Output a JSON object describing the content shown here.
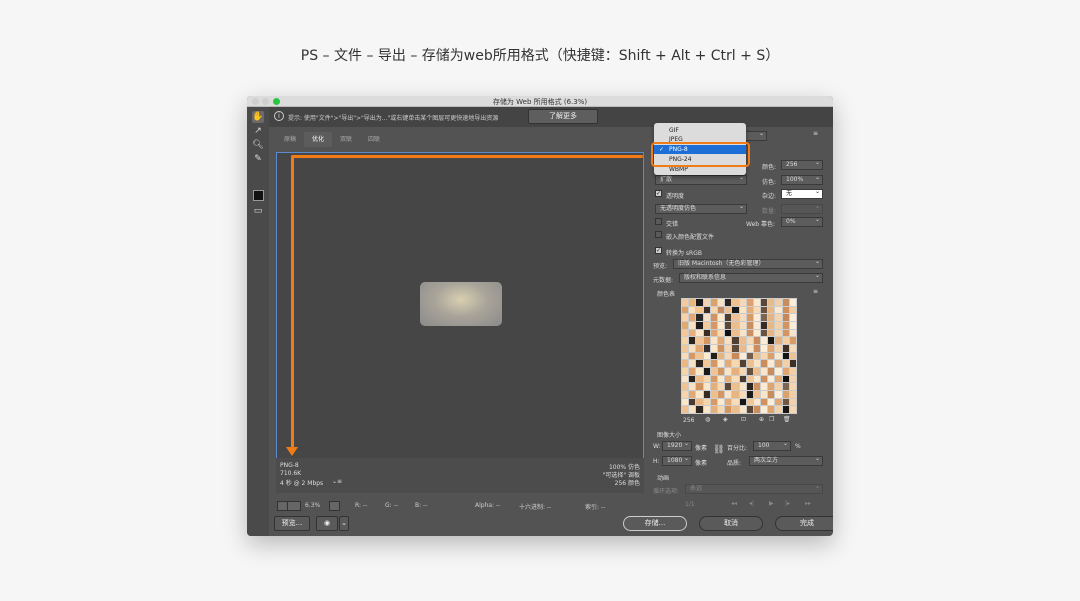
{
  "caption": "PS – 文件 – 导出 – 存储为web所用格式（快捷键：Shift + Alt + Ctrl + S）",
  "window": {
    "title": "存储为 Web 所用格式 (6.3%)",
    "hint": "提示: 使用\"文件\">\"导出\">\"导出为...\"或右键单击某个图层可更快速地导出资源",
    "learn_more": "了解更多"
  },
  "tabs": [
    "原稿",
    "优化",
    "双联",
    "四联"
  ],
  "image_info": {
    "format": "PNG-8",
    "size": "710.6K",
    "speed": "4 秒 @ 2 Mbps",
    "dither": "100% 仿色",
    "palette": "\"可选择\" 调板",
    "colors": "256 颜色"
  },
  "status": {
    "zoom": "6.3%",
    "r": "R: --",
    "g": "G: --",
    "b": "B: --",
    "alpha": "Alpha: --",
    "hex": "十六进制: --",
    "index": "索引: --"
  },
  "bottom": {
    "preview": "预览...",
    "save": "存储...",
    "cancel": "取消",
    "done": "完成"
  },
  "format_dropdown": {
    "options": [
      "GIF",
      "JPEG",
      "PNG-8",
      "PNG-24",
      "WBMP"
    ],
    "selected": "PNG-8"
  },
  "settings": {
    "colors_label": "颜色:",
    "colors_value": "256",
    "dither_label": "仿色:",
    "dither_value": "100%",
    "reduction_value": "扩散",
    "transparency_label": "透明度",
    "matte_label": "杂边:",
    "matte_value": "无",
    "trans_dither_value": "无透明度仿色",
    "amount_label": "数量:",
    "interlaced_label": "交错",
    "web_snap_label": "Web 靠色:",
    "web_snap_value": "0%",
    "embed_profile_label": "嵌入颜色配置文件",
    "convert_srgb_label": "转换为 sRGB",
    "preview_label": "预览:",
    "preview_value": "旧版 Macintosh（无色彩管理）",
    "metadata_label": "元数据:",
    "metadata_value": "版权和联系信息",
    "color_table_label": "颜色表",
    "color_count": "256",
    "image_size_label": "图像大小",
    "w_label": "W:",
    "w_value": "1920",
    "h_label": "H:",
    "h_value": "1080",
    "unit": "像素",
    "percent_label": "百分比:",
    "percent_value": "100",
    "percent_sign": "%",
    "quality_label": "品质:",
    "quality_value": "两次立方",
    "animation_label": "动画",
    "loop_label": "循环选项:",
    "loop_value": "永远",
    "frame_counter": "1/1"
  },
  "colors": {
    "accent_orange": "#f07b17",
    "selection_blue": "#1d6fd6",
    "panel_bg": "#535353"
  },
  "color_table": [
    "#f3c9a0",
    "#e8b77a",
    "#1a1a1a",
    "#f1d3b2",
    "#d9a46c",
    "#f7e3c8",
    "#2b2420",
    "#efc191",
    "#f5d9b8",
    "#e0a070",
    "#fbe8cf",
    "#5a4636",
    "#e8bb8a",
    "#f0cfa8",
    "#c98c5e",
    "#f9eedc",
    "#dba26e",
    "#fbe1bd",
    "#f4c58f",
    "#3b2f27",
    "#f6d6ad",
    "#c4895d",
    "#f1bf8e",
    "#181818",
    "#fae4c4",
    "#e4ac78",
    "#f7dcb6",
    "#6b5240",
    "#eab885",
    "#f9e9d2",
    "#d08e5c",
    "#f2cda2",
    "#f7d2a9",
    "#e3a874",
    "#2a2a2a",
    "#f5e1c7",
    "#cf9364",
    "#fde9cc",
    "#4d3d31",
    "#eec298",
    "#f6dcbc",
    "#d89b68",
    "#fbecd7",
    "#7a6552",
    "#e6b382",
    "#f4d3ae",
    "#c78758",
    "#faeedf",
    "#e0a873",
    "#f8e2c3",
    "#1f1b18",
    "#f0c99c",
    "#d69966",
    "#fcead0",
    "#594737",
    "#ebbe8e",
    "#f7ddbd",
    "#ca8f5f",
    "#f8ead6",
    "#362c25",
    "#e9b985",
    "#f3d0a6",
    "#d39560",
    "#f9ecd9",
    "#f2c898",
    "#e6af7c",
    "#f9e6cc",
    "#3a2d24",
    "#dfa46f",
    "#f6dab5",
    "#101010",
    "#eebe8d",
    "#f8e4c8",
    "#cd9061",
    "#fbebd3",
    "#6a5341",
    "#e8b682",
    "#f4d4ad",
    "#d29563",
    "#f7e6cf",
    "#f6d4ab",
    "#2d231d",
    "#efc597",
    "#d49762",
    "#fae7c9",
    "#e2aa76",
    "#f8dfbe",
    "#4f3f32",
    "#ecbd8d",
    "#f5d8b4",
    "#c98b5b",
    "#f9ebd5",
    "#1c1916",
    "#e5b07d",
    "#f2cea3",
    "#d89c67",
    "#f1c799",
    "#f7e0c0",
    "#e1a772",
    "#313131",
    "#f9e8cc",
    "#d0925f",
    "#f5d6af",
    "#5f4b3b",
    "#eabb89",
    "#f8e5c9",
    "#cc8e5d",
    "#fbeed9",
    "#dfa671",
    "#f3d2a9",
    "#402f27",
    "#f6dbb9",
    "#f8dcb7",
    "#d69864",
    "#f0c595",
    "#fbebd1",
    "#231e1a",
    "#e7b480",
    "#f6d9b3",
    "#c88a5a",
    "#faecd8",
    "#745e4b",
    "#ebbd8b",
    "#f4d5ae",
    "#da9f6b",
    "#f9e7cd",
    "#141414",
    "#eec293",
    "#e9b884",
    "#f7e2c5",
    "#2f2620",
    "#f1c999",
    "#d59863",
    "#fbead0",
    "#e3ab77",
    "#f5d7b0",
    "#524234",
    "#edc092",
    "#f8e3c6",
    "#cb8d5c",
    "#fae9d3",
    "#dca36e",
    "#f3d1a7",
    "#3d3029",
    "#f4d5ac",
    "#e0a571",
    "#fae8ce",
    "#191919",
    "#efc496",
    "#d39661",
    "#f9e4c7",
    "#e6b17e",
    "#f6d8b2",
    "#665040",
    "#ebbe8c",
    "#f8e6cb",
    "#c98c5c",
    "#fbecd5",
    "#dfa470",
    "#f2cfa5",
    "#f9e6ca",
    "#282220",
    "#ebba87",
    "#f5d6ae",
    "#d79a66",
    "#fbe9cf",
    "#e4ad79",
    "#f7ddba",
    "#473a2e",
    "#f0c796",
    "#f9e9d0",
    "#ce905f",
    "#faeedb",
    "#e1a974",
    "#111111",
    "#f4d3aa",
    "#efc394",
    "#f8e1c3",
    "#d1935f",
    "#fae6ca",
    "#e5af7b",
    "#f6d9b4",
    "#5b4838",
    "#ecbf8f",
    "#f8e4c7",
    "#2b241f",
    "#cd8f5e",
    "#fbebd4",
    "#dea570",
    "#f3d0a7",
    "#7c6653",
    "#f5d7af",
    "#f5d5ac",
    "#e2a974",
    "#fae7cc",
    "#352b24",
    "#edbf8f",
    "#d59761",
    "#f9e3c6",
    "#e8b581",
    "#f6dbb7",
    "#1e1a17",
    "#eec090",
    "#f8e6ca",
    "#ca8c5b",
    "#fbedd7",
    "#dca26d",
    "#f2ceA4",
    "#fae8cd",
    "#4a3b2f",
    "#e9b785",
    "#f4d4ab",
    "#d89b66",
    "#fbead2",
    "#e3ac78",
    "#f7debb",
    "#161616",
    "#f1c898",
    "#f9e8cf",
    "#cf915f",
    "#fbeedb",
    "#e0a873",
    "#6f5746",
    "#f4d2a9",
    "#efc192",
    "#f8e2c4",
    "#2e2520",
    "#fae5c9",
    "#e6b07c",
    "#f6d8b3",
    "#d49661",
    "#ecbe8e",
    "#f8e5c8",
    "#574535",
    "#cc8e5d",
    "#fbecd6",
    "#dea36f",
    "#f3d1a8",
    "#1a1715",
    "#f5d6ae"
  ]
}
